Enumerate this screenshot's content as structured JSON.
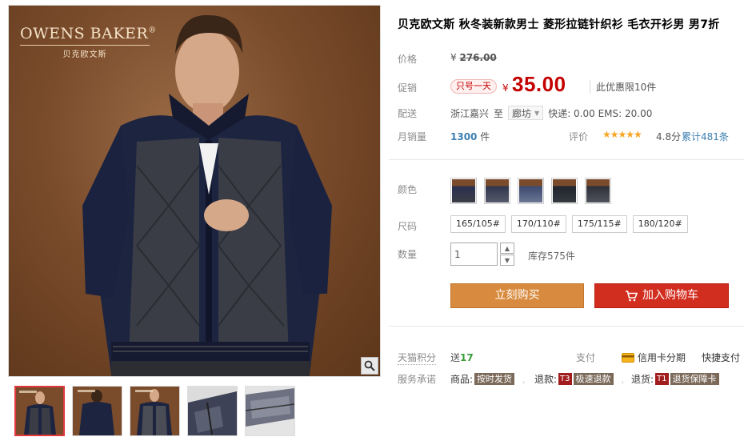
{
  "brand": {
    "name_en": "OWENS BAKER",
    "reg": "®",
    "name_cn": "贝克欧文斯"
  },
  "product": {
    "title": "贝克欧文斯 秋冬装新款男士 菱形拉链针织衫 毛衣开衫男 男7折"
  },
  "labels": {
    "price": "价格",
    "promo": "促销",
    "ship": "配送",
    "sales": "月销量",
    "rating": "评价",
    "color": "颜色",
    "size": "尺码",
    "qty": "数量",
    "points": "天猫积分",
    "pay": "支付",
    "service": "服务承诺"
  },
  "price": {
    "currency": "¥",
    "original": "276.00",
    "promo_tag": "只号一天",
    "current": "35.00",
    "limit": "此优惠限10件"
  },
  "shipping": {
    "from": "浙江嘉兴",
    "to_word": "至",
    "destination": "廊坊",
    "fees": "快递: 0.00 EMS: 20.00"
  },
  "sales": {
    "count": "1300",
    "unit": "件"
  },
  "rating": {
    "stars": "★★★★★",
    "score": "4.8分",
    "reviews": "累计481条"
  },
  "sizes": [
    "165/105#",
    "170/110#",
    "175/115#",
    "180/120#"
  ],
  "quantity": {
    "value": "1",
    "stock": "库存575件"
  },
  "buttons": {
    "buy": "立刻购买",
    "cart": "加入购物车"
  },
  "points": {
    "prefix": "送",
    "value": "17"
  },
  "payment": {
    "credit": "信用卡分期",
    "quick": "快捷支付"
  },
  "services": [
    {
      "label": "商品:",
      "code": "",
      "tag": "按时发货"
    },
    {
      "label": "退款:",
      "code": "T3",
      "tag": "极速退款"
    },
    {
      "label": "退货:",
      "code": "T1",
      "tag": "退货保障卡"
    }
  ],
  "icons": {
    "zoom": "search-icon",
    "cart": "cart-icon",
    "credit": "credit-card-icon"
  },
  "colors": {
    "price_red": "#c40000",
    "buy_button": "#d88b3e",
    "cart_button": "#d22e1f",
    "link_blue": "#3c7fb1",
    "points_green": "#3a9c3a"
  }
}
